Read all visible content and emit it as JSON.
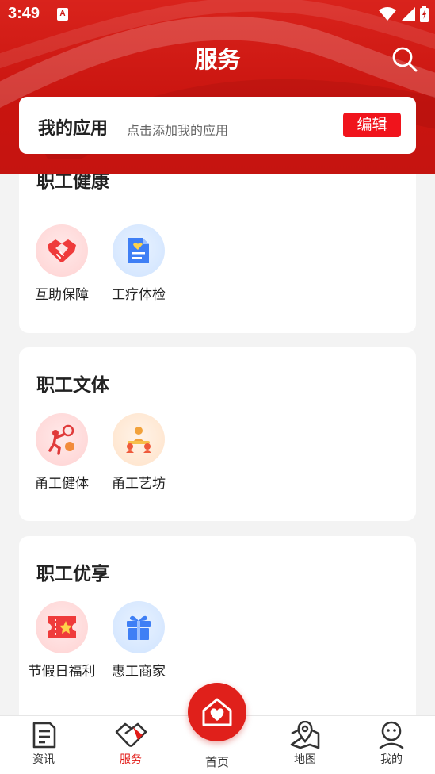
{
  "status_bar": {
    "time": "3:49",
    "notification_badge": "A"
  },
  "header": {
    "title": "服务"
  },
  "my_apps": {
    "title": "我的应用",
    "hint": "点击添加我的应用",
    "edit_label": "编辑"
  },
  "sections": [
    {
      "title": "职工健康",
      "apps": [
        {
          "label": "互助保障",
          "icon": "handshake-icon",
          "color": "red"
        },
        {
          "label": "工疗体检",
          "icon": "medical-report-icon",
          "color": "blue"
        }
      ]
    },
    {
      "title": "职工文体",
      "apps": [
        {
          "label": "甬工健体",
          "icon": "sports-icon",
          "color": "red"
        },
        {
          "label": "甬工艺坊",
          "icon": "art-workshop-icon",
          "color": "orange"
        }
      ]
    },
    {
      "title": "职工优享",
      "apps": [
        {
          "label": "节假日福利",
          "icon": "ticket-icon",
          "color": "red"
        },
        {
          "label": "惠工商家",
          "icon": "gift-icon",
          "color": "blue"
        }
      ]
    }
  ],
  "tabbar": {
    "items": [
      {
        "label": "资讯",
        "icon": "news-icon"
      },
      {
        "label": "服务",
        "icon": "service-icon",
        "active": true
      },
      {
        "label": "首页",
        "icon": "home-heart-icon"
      },
      {
        "label": "地图",
        "icon": "map-icon"
      },
      {
        "label": "我的",
        "icon": "profile-icon"
      }
    ]
  },
  "colors": {
    "brand_red": "#d9231c",
    "accent_red": "#f0141c",
    "active_tab": "#e21b17"
  }
}
